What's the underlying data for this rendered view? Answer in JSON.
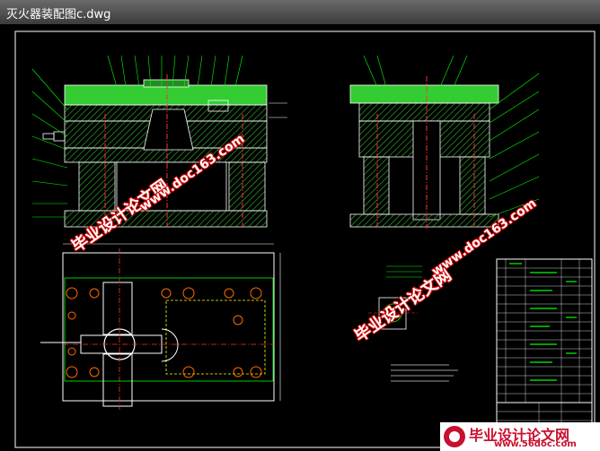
{
  "window": {
    "title": "灭火器装配图c.dwg"
  },
  "watermarks": {
    "cn_text": "毕业设计论文网",
    "url_text": "www.doc163.com"
  },
  "brand": {
    "cn": "毕业设计论文网",
    "url": "www.56doc.com"
  },
  "colors": {
    "line_white": "#ffffff",
    "line_green": "#00ff00",
    "hatch_green": "#3fbf3f",
    "center_red": "#ff2020",
    "dim_cyan": "#00ffff",
    "frame": "#ffffff",
    "watermark_red": "#cc0000"
  }
}
